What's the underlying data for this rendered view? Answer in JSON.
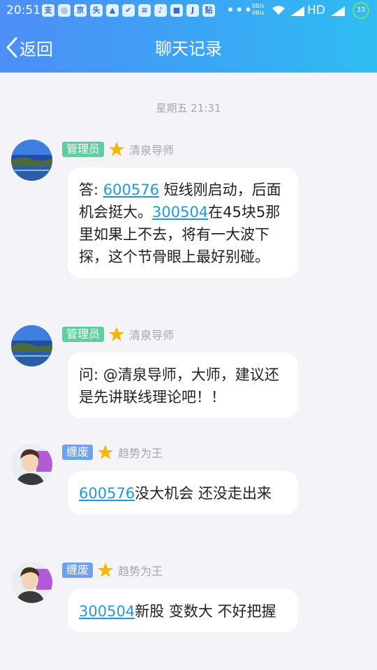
{
  "status_bar": {
    "time": "20:51",
    "net_up": "0B/s",
    "net_down": "0B/s",
    "network": "HD",
    "battery": "33"
  },
  "header": {
    "back_label": "返回",
    "title": "聊天记录"
  },
  "timestamp": "星期五 21:31",
  "messages": [
    {
      "badge": "管理员",
      "nickname": "清泉导师",
      "parts": {
        "p0": "答: ",
        "link0": "600576",
        "p1": " 短线刚启动，后面机会挺大。",
        "link1": "300504",
        "p2": "在45块5那里如果上不去，将有一大波下探，这个节骨眼上最好别碰。"
      }
    },
    {
      "badge": "管理员",
      "nickname": "清泉导师",
      "parts": {
        "p0": "问: @清泉导师，大师，建议还是先讲联线理论吧！！"
      }
    },
    {
      "badge": "缠废",
      "nickname": "趋势为王",
      "parts": {
        "link0": "600576",
        "p1": "没大机会 还没走出来"
      }
    },
    {
      "badge": "缠废",
      "nickname": "趋势为王",
      "parts": {
        "link0": "300504",
        "p1": "新股 变数大 不好把握"
      }
    }
  ],
  "colors": {
    "header_gradient_start": "#4d8ef7",
    "header_gradient_end": "#2fbdf2",
    "link": "#1f9ae0",
    "admin_badge": "#5fcfa0",
    "level_badge": "#6ea0ee",
    "background": "#f4f4f8"
  },
  "icons": [
    "back-chevron-icon",
    "star-icon",
    "wifi-icon",
    "signal-icon",
    "battery-icon"
  ]
}
